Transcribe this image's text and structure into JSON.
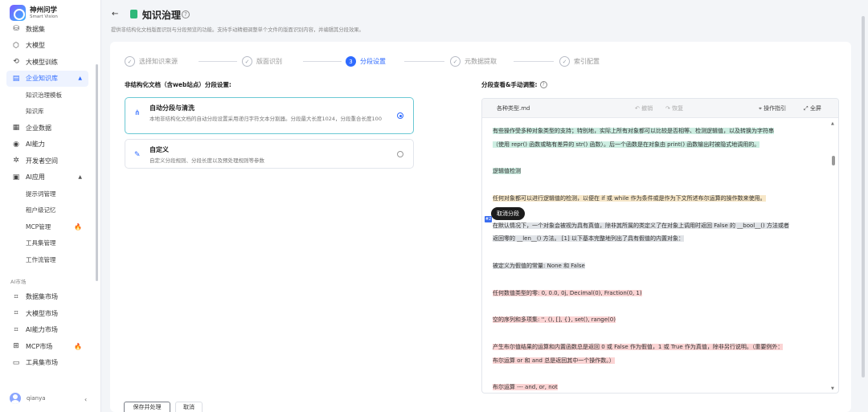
{
  "brand": {
    "name": "神州问学",
    "subtitle": "Smart Vision"
  },
  "sidebar": {
    "items": [
      {
        "label": "数据集",
        "icon": "database-icon"
      },
      {
        "label": "大模型",
        "icon": "cube-icon"
      },
      {
        "label": "大模型训练",
        "icon": "train-icon"
      },
      {
        "label": "企业知识库",
        "icon": "book-icon",
        "active": true
      },
      {
        "label": "知识治理模板"
      },
      {
        "label": "知识库"
      },
      {
        "label": "企业数据",
        "icon": "enterprise-data-icon"
      },
      {
        "label": "AI能力",
        "icon": "ai-ability-icon"
      },
      {
        "label": "开发者空间",
        "icon": "developer-icon"
      },
      {
        "label": "AI应用",
        "icon": "apps-icon"
      },
      {
        "label": "提示词管理"
      },
      {
        "label": "租户级记忆"
      },
      {
        "label": "MCP管理"
      },
      {
        "label": "工具集管理"
      },
      {
        "label": "工作流管理"
      }
    ],
    "section_label": "AI市场",
    "market_items": [
      {
        "label": "数据集市场"
      },
      {
        "label": "大模型市场"
      },
      {
        "label": "AI能力市场"
      },
      {
        "label": "MCP市场"
      },
      {
        "label": "工具集市场"
      }
    ],
    "user": "qianya"
  },
  "header": {
    "title": "知识治理",
    "description": "提供非结构化文档版面识别与分段预览的功能。支持手动精细调整单个文件的版面识别内容，并编辑其分段效果。"
  },
  "steps": [
    {
      "label": "选择知识来源",
      "state": "done"
    },
    {
      "label": "版面识别",
      "state": "done"
    },
    {
      "label": "分段设置",
      "state": "current",
      "num": "3"
    },
    {
      "label": "元数据提取",
      "state": "done"
    },
    {
      "label": "索引配置",
      "state": "done"
    }
  ],
  "left": {
    "title": "非结构化文档（含web站点）分段设置:",
    "options": [
      {
        "title": "自动分段与清洗",
        "desc": "本地非结构化文档的自动分段设置采用递归字符文本分割器。分段最大长度1024，分段重合长度100",
        "selected": true
      },
      {
        "title": "自定义",
        "desc": "自定义分段规则、分段长度以及预处理规则等参数",
        "selected": false
      }
    ]
  },
  "right": {
    "title": "分段查看&手动调整:",
    "file_name": "各种类型.md",
    "undo": "撤销",
    "redo": "恢复",
    "guide": "操作指引",
    "fullscreen": "全屏",
    "tooltip": "取消分段",
    "badge": "#2",
    "lines": [
      {
        "text": "有些操作受多种对象类型的支持；特别地，实际上所有对象都可以比较是否相等、检测逻辑值，以及转换为字符串",
        "hl": "hl-g"
      },
      {
        "text": "（使用 repr() 函数或略有差异的 str() 函数）。后一个函数是在对象由 print() 函数输出时被隐式地调用的。",
        "hl": "hl-g"
      },
      {
        "text": "",
        "hl": ""
      },
      {
        "text": "逻辑值检测",
        "hl": "hl-g"
      },
      {
        "text": "",
        "hl": ""
      },
      {
        "text": "任何对象都可以进行逻辑值的检测，以便在 if 或 while 作为条件或是作为下文所述布尔运算的操作数来使用。",
        "hl": "hl-y"
      },
      {
        "text": "",
        "hl": ""
      },
      {
        "text": "在默认情况下，一个对象会被视为具有真值，除非其所属的类定义了在对象上调用时返回 False 的 __bool__() 方法或者",
        "hl": "hl-gray"
      },
      {
        "text": "返回零的 __len__() 方法。 [1] 以下基本完整地列出了具有假值的内置对象：",
        "hl": "hl-gray"
      },
      {
        "text": "",
        "hl": ""
      },
      {
        "text": "被定义为假值的常量: None 和 False",
        "hl": "hl-gray"
      },
      {
        "text": "",
        "hl": ""
      },
      {
        "text": "任何数值类型的零: 0, 0.0, 0j, Decimal(0), Fraction(0, 1)",
        "hl": "hl-p"
      },
      {
        "text": "",
        "hl": ""
      },
      {
        "text": "空的序列和多项集: '', (), [], {}, set(), range(0)",
        "hl": "hl-p"
      },
      {
        "text": "",
        "hl": ""
      },
      {
        "text": "产生布尔值结果的运算和内置函数总是返回 0 或 False 作为假值，1 或 True 作为真值，除非另行说明。（重要例外：",
        "hl": "hl-p"
      },
      {
        "text": "布尔运算 or 和 and 总是返回其中一个操作数。）",
        "hl": "hl-p"
      },
      {
        "text": "",
        "hl": ""
      },
      {
        "text": "布尔运算 --- and, or, not",
        "hl": "hl-p"
      }
    ]
  },
  "footer": {
    "save": "保存并处理",
    "cancel": "取消"
  }
}
